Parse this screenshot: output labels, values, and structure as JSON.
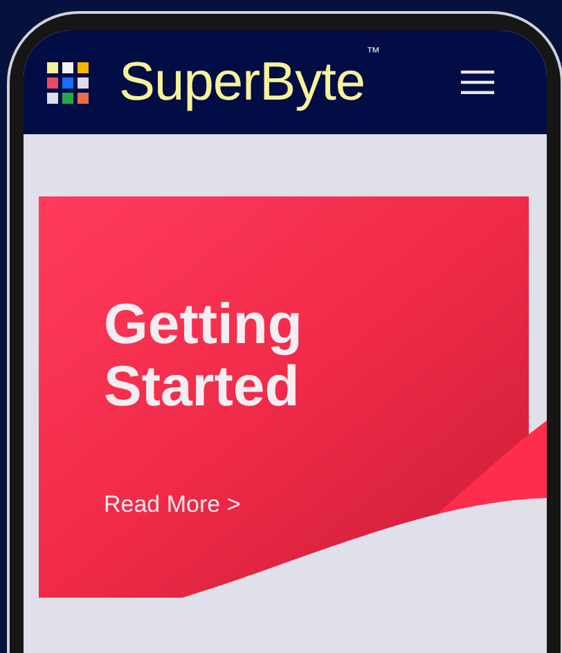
{
  "header": {
    "brand": "SuperByte",
    "trademark": "™"
  },
  "hero": {
    "title": "Getting Started",
    "link": "Read More >"
  }
}
